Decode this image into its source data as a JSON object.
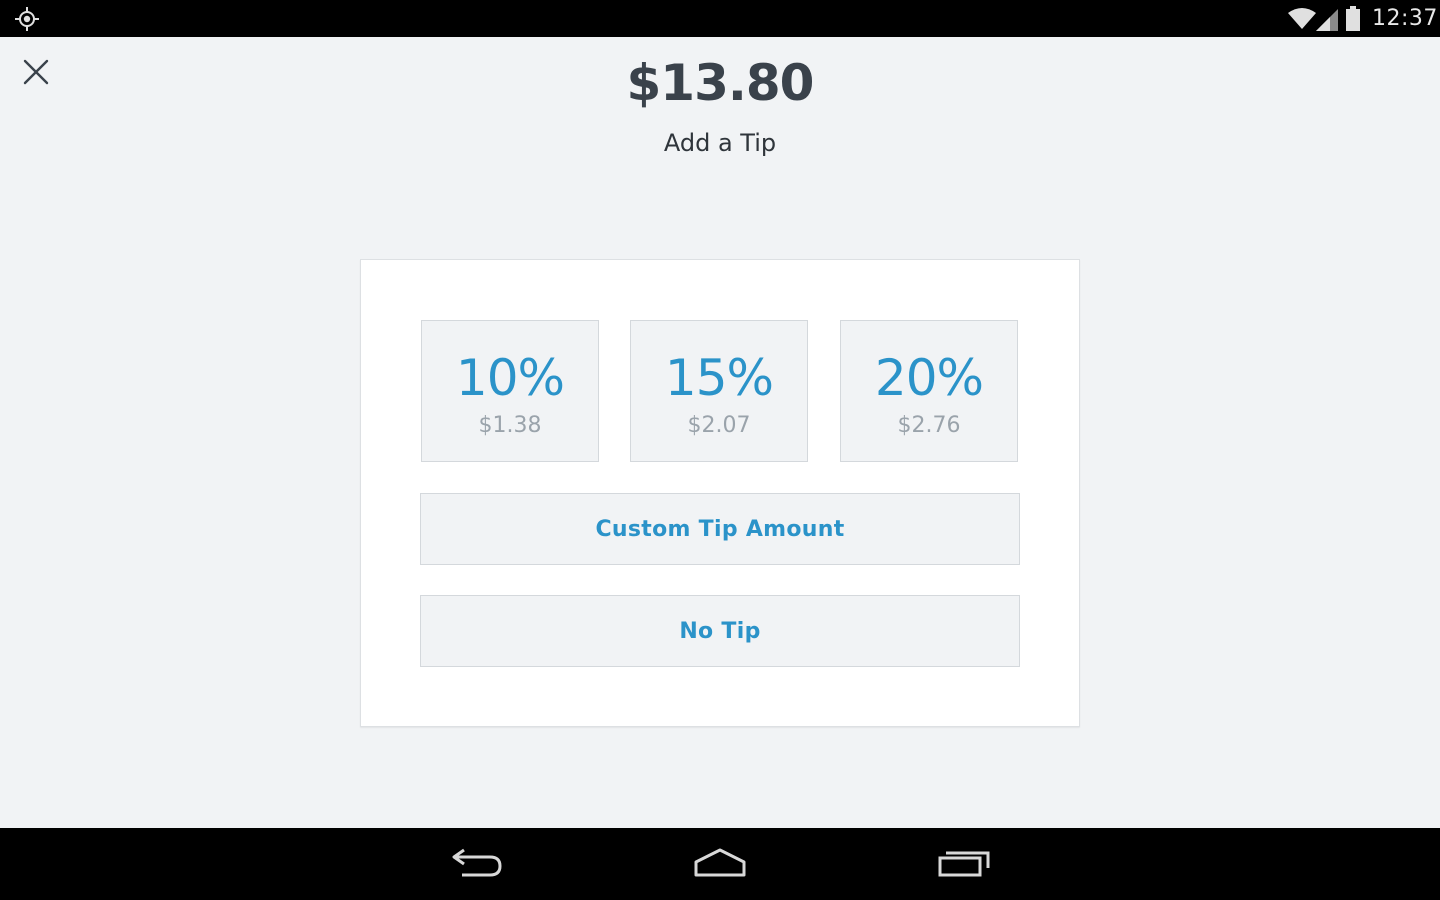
{
  "status_bar": {
    "left_icon": "location-icon",
    "right_icons": [
      "wifi-icon",
      "signal-icon",
      "battery-icon"
    ],
    "time": "12:37"
  },
  "header": {
    "close_icon": "close-icon",
    "total": "$13.80",
    "subtitle": "Add a Tip"
  },
  "tip_options": [
    {
      "percent": "10%",
      "amount": "$1.38"
    },
    {
      "percent": "15%",
      "amount": "$2.07"
    },
    {
      "percent": "20%",
      "amount": "$2.76"
    }
  ],
  "buttons": {
    "custom_tip": "Custom Tip Amount",
    "no_tip": "No Tip"
  },
  "nav_bar": {
    "icons": [
      "back-icon",
      "home-icon",
      "recent-apps-icon"
    ]
  },
  "colors": {
    "accent": "#2b93c9",
    "background": "#f1f3f5",
    "card": "#ffffff",
    "text_dark": "#3a424b",
    "text_muted": "#9aa3ab"
  }
}
